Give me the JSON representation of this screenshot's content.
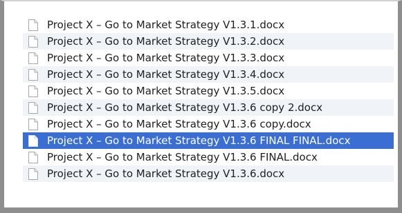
{
  "files": [
    {
      "name": "Project X – Go to Market Strategy V1.3.1.docx",
      "icon": "document-icon",
      "selected": false
    },
    {
      "name": "Project X – Go to Market Strategy V1.3.2.docx",
      "icon": "document-icon",
      "selected": false
    },
    {
      "name": "Project X – Go to Market Strategy V1.3.3.docx",
      "icon": "document-icon",
      "selected": false
    },
    {
      "name": "Project X – Go to Market Strategy V1.3.4.docx",
      "icon": "document-icon",
      "selected": false
    },
    {
      "name": "Project X – Go to Market Strategy V1.3.5.docx",
      "icon": "document-icon",
      "selected": false
    },
    {
      "name": "Project X – Go to Market Strategy V1.3.6 copy 2.docx",
      "icon": "document-icon",
      "selected": false
    },
    {
      "name": "Project X – Go to Market Strategy V1.3.6 copy.docx",
      "icon": "document-icon",
      "selected": false
    },
    {
      "name": "Project X – Go to Market Strategy V1.3.6 FINAL FINAL.docx",
      "icon": "document-icon",
      "selected": true
    },
    {
      "name": "Project X – Go to Market Strategy V1.3.6 FINAL.docx",
      "icon": "document-icon",
      "selected": false
    },
    {
      "name": "Project X – Go to Market Strategy V1.3.6.docx",
      "icon": "document-icon",
      "selected": false
    }
  ],
  "colors": {
    "selection": "#3a6ed3",
    "alternate_row": "#f0f3f8",
    "frame": "#8e8e8e"
  }
}
